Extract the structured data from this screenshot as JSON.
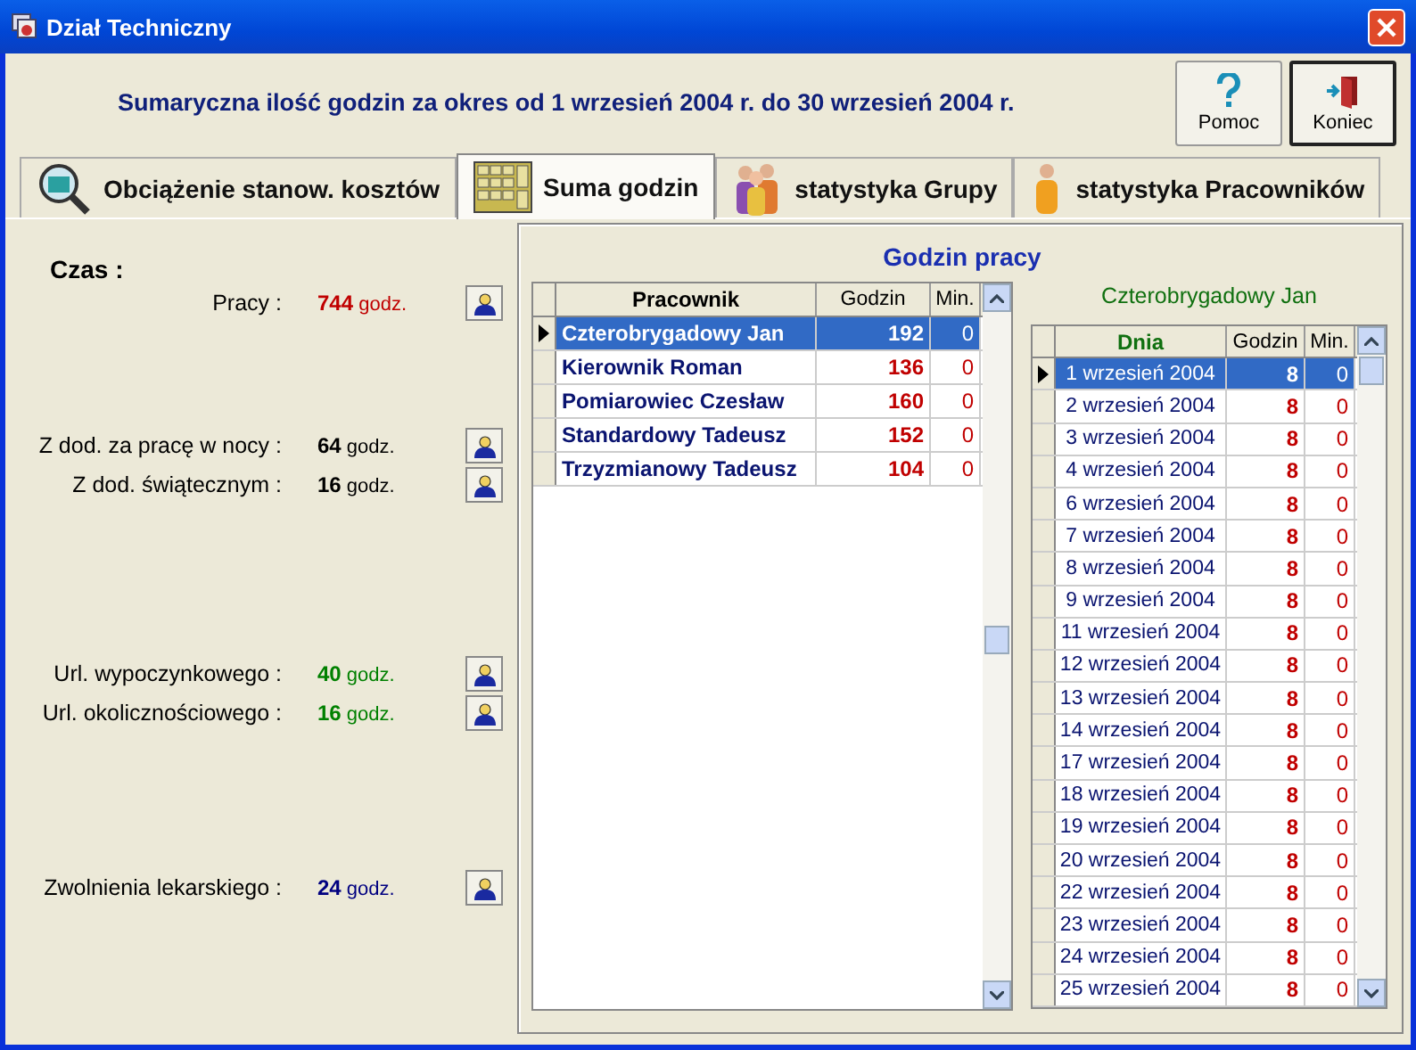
{
  "window": {
    "title": "Dział Techniczny"
  },
  "summary": "Sumaryczna ilość godzin za okres od 1 wrzesień 2004 r. do 30 wrzesień 2004 r.",
  "buttons": [
    {
      "label": "Pomoc",
      "kind": "help"
    },
    {
      "label": "Koniec",
      "kind": "exit"
    }
  ],
  "tabs": [
    {
      "label": "Obciążenie stanow. kosztów",
      "kind": "magnifier",
      "selected": false
    },
    {
      "label": "Suma godzin",
      "kind": "calculator",
      "selected": true
    },
    {
      "label": "statystyka Grupy",
      "kind": "group",
      "selected": false
    },
    {
      "label": "statystyka Pracowników",
      "kind": "person",
      "selected": false
    }
  ],
  "time_panel": {
    "heading": "Czas :",
    "groups": [
      [
        {
          "label": "Pracy :",
          "value": "744",
          "unit": "godz.",
          "color": "#c00000"
        }
      ],
      [
        {
          "label": "Z dod. za pracę w nocy :",
          "value": "64",
          "unit": "godz.",
          "color": "#000000"
        },
        {
          "label": "Z dod. świątecznym :",
          "value": "16",
          "unit": "godz.",
          "color": "#000000"
        }
      ],
      [
        {
          "label": "Url. wypoczynkowego :",
          "value": "40",
          "unit": "godz.",
          "color": "#008000"
        },
        {
          "label": "Url. okolicznościowego :",
          "value": "16",
          "unit": "godz.",
          "color": "#008000"
        }
      ],
      [
        {
          "label": "Zwolnienia lekarskiego :",
          "value": "24",
          "unit": "godz.",
          "color": "#000080"
        }
      ]
    ]
  },
  "hours_panel": {
    "title": "Godzin pracy",
    "employees": {
      "columns": [
        "Pracownik",
        "Godzin",
        "Min."
      ],
      "rows": [
        {
          "name": "Czterobrygadowy Jan",
          "hours": "192",
          "min": "0",
          "selected": true
        },
        {
          "name": "Kierownik Roman",
          "hours": "136",
          "min": "0",
          "selected": false
        },
        {
          "name": "Pomiarowiec Czesław",
          "hours": "160",
          "min": "0",
          "selected": false
        },
        {
          "name": "Standardowy Tadeusz",
          "hours": "152",
          "min": "0",
          "selected": false
        },
        {
          "name": "Trzyzmianowy Tadeusz",
          "hours": "104",
          "min": "0",
          "selected": false
        }
      ]
    },
    "detail_title": "Czterobrygadowy Jan",
    "days": {
      "columns": [
        "Dnia",
        "Godzin",
        "Min."
      ],
      "rows": [
        {
          "day": "1 wrzesień 2004",
          "hours": "8",
          "min": "0",
          "selected": true
        },
        {
          "day": "2 wrzesień 2004",
          "hours": "8",
          "min": "0",
          "selected": false
        },
        {
          "day": "3 wrzesień 2004",
          "hours": "8",
          "min": "0",
          "selected": false
        },
        {
          "day": "4 wrzesień 2004",
          "hours": "8",
          "min": "0",
          "selected": false
        },
        {
          "day": "6 wrzesień 2004",
          "hours": "8",
          "min": "0",
          "selected": false
        },
        {
          "day": "7 wrzesień 2004",
          "hours": "8",
          "min": "0",
          "selected": false
        },
        {
          "day": "8 wrzesień 2004",
          "hours": "8",
          "min": "0",
          "selected": false
        },
        {
          "day": "9 wrzesień 2004",
          "hours": "8",
          "min": "0",
          "selected": false
        },
        {
          "day": "11 wrzesień 2004",
          "hours": "8",
          "min": "0",
          "selected": false
        },
        {
          "day": "12 wrzesień 2004",
          "hours": "8",
          "min": "0",
          "selected": false
        },
        {
          "day": "13 wrzesień 2004",
          "hours": "8",
          "min": "0",
          "selected": false
        },
        {
          "day": "14 wrzesień 2004",
          "hours": "8",
          "min": "0",
          "selected": false
        },
        {
          "day": "17 wrzesień 2004",
          "hours": "8",
          "min": "0",
          "selected": false
        },
        {
          "day": "18 wrzesień 2004",
          "hours": "8",
          "min": "0",
          "selected": false
        },
        {
          "day": "19 wrzesień 2004",
          "hours": "8",
          "min": "0",
          "selected": false
        },
        {
          "day": "20 wrzesień 2004",
          "hours": "8",
          "min": "0",
          "selected": false
        },
        {
          "day": "22 wrzesień 2004",
          "hours": "8",
          "min": "0",
          "selected": false
        },
        {
          "day": "23 wrzesień 2004",
          "hours": "8",
          "min": "0",
          "selected": false
        },
        {
          "day": "24 wrzesień 2004",
          "hours": "8",
          "min": "0",
          "selected": false
        },
        {
          "day": "25 wrzesień 2004",
          "hours": "8",
          "min": "0",
          "selected": false
        }
      ]
    }
  }
}
